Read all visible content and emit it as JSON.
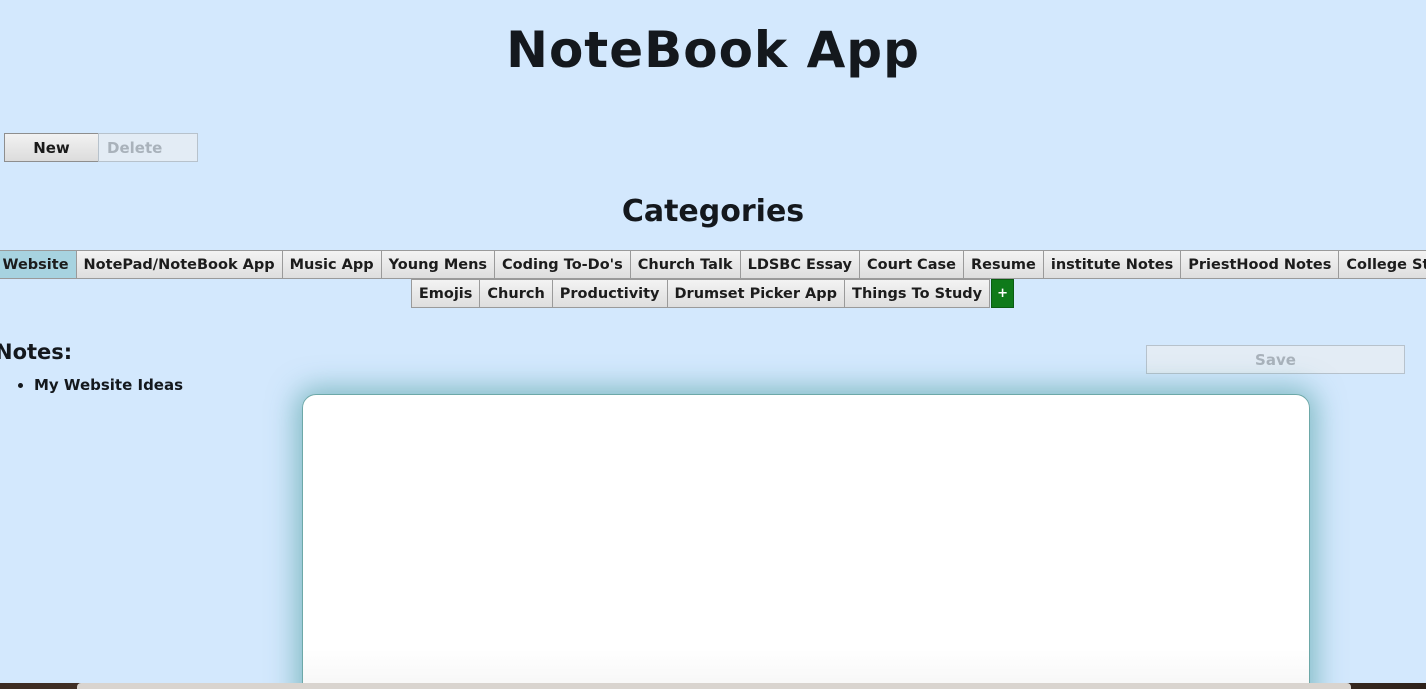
{
  "app": {
    "title": "NoteBook App"
  },
  "toolbar": {
    "new_label": "New",
    "delete_label": "Delete",
    "save_label": "Save"
  },
  "categories": {
    "heading": "Categories",
    "active": "My Website",
    "row1": [
      "My Website",
      "NotePad/NoteBook App",
      "Music App",
      "Young Mens",
      "Coding To-Do's",
      "Church Talk",
      "LDSBC Essay",
      "Court Case",
      "Resume",
      "institute Notes",
      "PriestHood Notes",
      "College Stuff"
    ],
    "row2": [
      "Emojis",
      "Church",
      "Productivity",
      "Drumset Picker App",
      "Things To Study"
    ],
    "add_label": "+"
  },
  "notes": {
    "label": "Notes:",
    "items": [
      "My Website Ideas"
    ]
  },
  "editor": {
    "value": ""
  },
  "colors": {
    "background": "#d3e8fd",
    "active_tab": "#a7d3e0",
    "add_button": "#0f7a1a",
    "editor_glow": "#3c9696"
  }
}
